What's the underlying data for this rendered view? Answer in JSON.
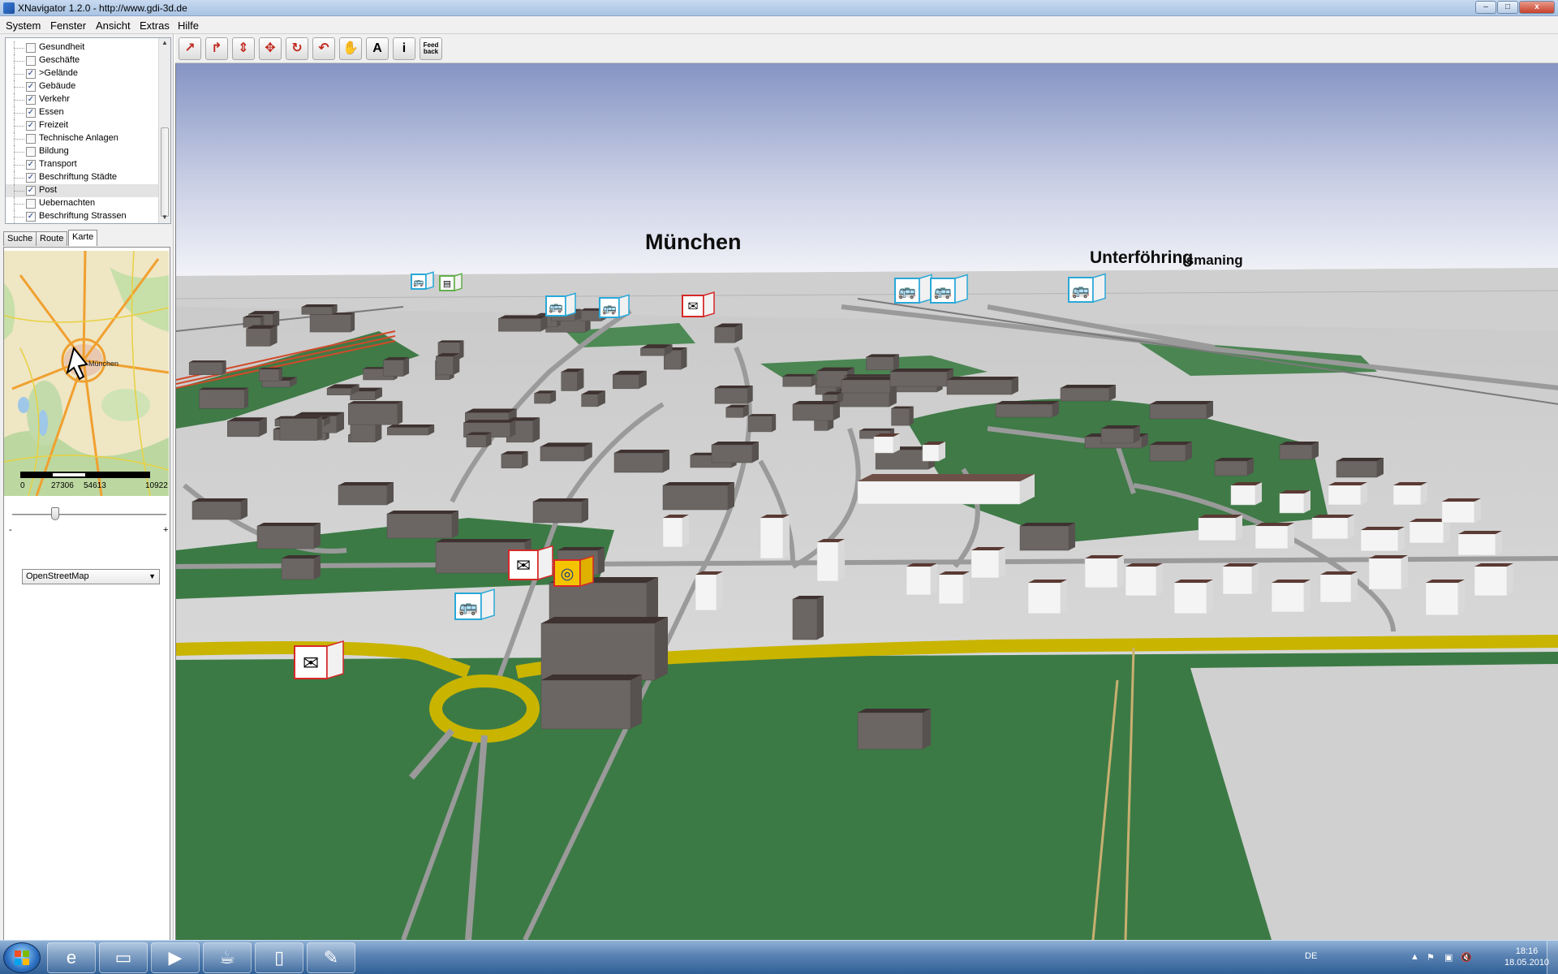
{
  "window": {
    "title": "XNavigator 1.2.0 - http://www.gdi-3d.de",
    "minimize": "–",
    "maximize": "□",
    "close": "x"
  },
  "menu": [
    "System",
    "Fenster",
    "Ansicht",
    "Extras",
    "Hilfe"
  ],
  "layers": [
    {
      "label": "Gesundheit",
      "checked": false
    },
    {
      "label": "Geschäfte",
      "checked": false
    },
    {
      "label": ">Gelände",
      "checked": true
    },
    {
      "label": "Gebäude",
      "checked": true
    },
    {
      "label": "Verkehr",
      "checked": true
    },
    {
      "label": "Essen",
      "checked": true
    },
    {
      "label": "Freizeit",
      "checked": true
    },
    {
      "label": "Technische Anlagen",
      "checked": false
    },
    {
      "label": "Bildung",
      "checked": false
    },
    {
      "label": "Transport",
      "checked": true
    },
    {
      "label": "Beschriftung Städte",
      "checked": true
    },
    {
      "label": "Post",
      "checked": true,
      "selected": true
    },
    {
      "label": "Uebernachten",
      "checked": false
    },
    {
      "label": "Beschriftung Strassen",
      "checked": true
    }
  ],
  "tabs": [
    "Suche",
    "Route",
    "Karte"
  ],
  "active_tab": "Karte",
  "minimap": {
    "city_label": "München",
    "scale": [
      "0",
      "27306",
      "54613",
      "10922"
    ],
    "zoom_minus": "-",
    "zoom_plus": "+",
    "base_layer": "OpenStreetMap"
  },
  "toolbar": [
    {
      "name": "fly-icon",
      "glyph": "↗",
      "color": "#c0281e"
    },
    {
      "name": "turn-icon",
      "glyph": "↱",
      "color": "#c0281e"
    },
    {
      "name": "move-vertical-icon",
      "glyph": "⇕",
      "color": "#c0281e"
    },
    {
      "name": "move-cross-icon",
      "glyph": "✥",
      "color": "#c0281e"
    },
    {
      "name": "rotate-icon",
      "glyph": "↻",
      "color": "#c0281e"
    },
    {
      "name": "return-icon",
      "glyph": "↶",
      "color": "#c0281e"
    },
    {
      "name": "hand-icon",
      "glyph": "✋",
      "color": "#333333"
    },
    {
      "name": "label-icon",
      "glyph": "A",
      "color": "#000000"
    },
    {
      "name": "info-icon",
      "glyph": "i",
      "color": "#000000"
    }
  ],
  "feedback_button": [
    "Feed",
    "back"
  ],
  "scene_labels": {
    "city_main": "München",
    "city_right": "Unterföhring",
    "city_far": "Ismaning"
  },
  "taskbar": {
    "apps": [
      {
        "name": "internet-explorer-icon",
        "glyph": "e"
      },
      {
        "name": "folder-icon",
        "glyph": "▭"
      },
      {
        "name": "media-player-icon",
        "glyph": "▶"
      },
      {
        "name": "java-icon",
        "glyph": "☕"
      },
      {
        "name": "document-icon",
        "glyph": "▯"
      },
      {
        "name": "paint-icon",
        "glyph": "✎"
      }
    ],
    "language": "DE",
    "time": "18:16",
    "date": "18.05.2010"
  },
  "colors": {
    "sky_top": "#8594c4",
    "sky_bottom": "#eef0f6",
    "ground": "#d9d9d9",
    "grass": "#3f7a47",
    "road_yellow": "#c9b400",
    "building_dark": "#5f5a57",
    "building_white": "#f4f4f4"
  }
}
